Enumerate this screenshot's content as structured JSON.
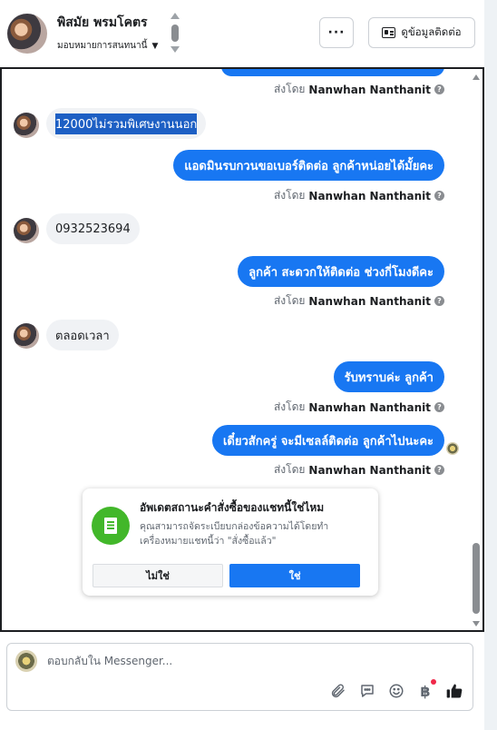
{
  "header": {
    "contact_name": "พิสมัย พรมโคตร",
    "assign_label": "มอบหมายการสนทนานี้",
    "more_label": "···",
    "view_contact_label": "ดูข้อมูลติดต่อ"
  },
  "conversation": {
    "messages": [
      {
        "direction": "in",
        "text": "12000ไม่รวมพิเศษงานนอก"
      },
      {
        "direction": "out",
        "text": "แอดมินรบกวนขอเบอร์ติดต่อ ลูกค้าหน่อยได้มั้ยคะ"
      },
      {
        "direction": "in",
        "text": "0932523694"
      },
      {
        "direction": "out",
        "text": "ลูกค้า สะดวกให้ติดต่อ ช่วงกี่โมงดีคะ"
      },
      {
        "direction": "in",
        "text": "ตลอดเวลา"
      },
      {
        "direction": "out",
        "text": "รับทราบค่ะ  ลูกค้า"
      },
      {
        "direction": "out",
        "text": "เดี๋ยวสักครู่  จะมีเซลล์ติดต่อ ลูกค้าไปนะคะ"
      }
    ],
    "sent_by_prefix": "ส่งโดย",
    "sent_by_name": "Nanwhan Nanthanit",
    "info_glyph": "?"
  },
  "order_prompt": {
    "title": "อัพเดตสถานะคำสั่งซื้อของแชทนี้ใช่ไหม",
    "description": "คุณสามารถจัดระเบียบกล่องข้อความได้โดยทำเครื่องหมายแชทนี้ว่า \"สั่งซื้อแล้ว\"",
    "no_label": "ไม่ใช่",
    "yes_label": "ใช่"
  },
  "composer": {
    "placeholder": "ตอบกลับใน Messenger...",
    "tools": [
      "attachment-icon",
      "saved-reply-icon",
      "emoji-icon",
      "payment-icon",
      "like-icon"
    ],
    "payment_glyph": "฿"
  },
  "colors": {
    "outgoing_bubble": "#1877f2",
    "incoming_bubble": "#f0f2f5",
    "accent_green": "#42b72a",
    "notification_dot": "#f02849"
  }
}
